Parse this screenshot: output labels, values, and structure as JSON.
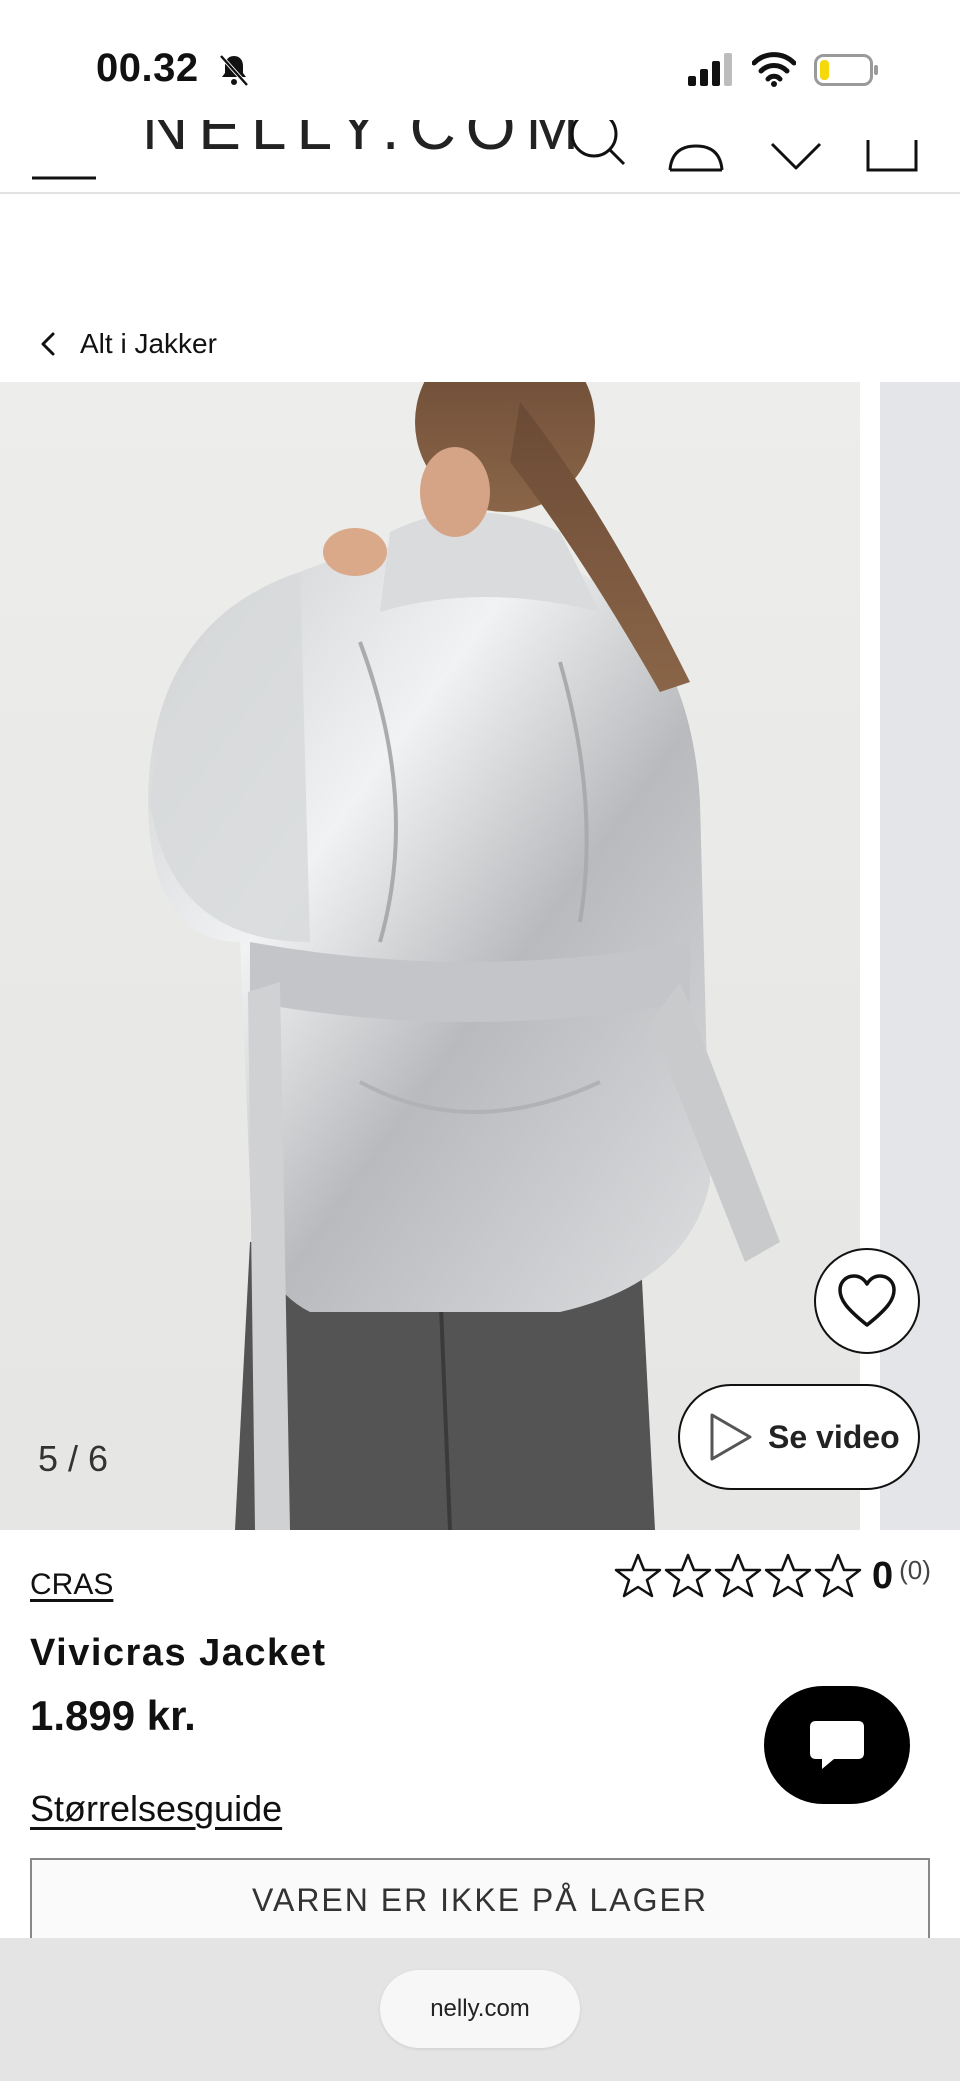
{
  "status_bar": {
    "time": "00.32"
  },
  "header": {
    "logo": "NELLY.COM"
  },
  "breadcrumb": {
    "label": "Alt i Jakker"
  },
  "gallery": {
    "counter": "5 / 6",
    "video_label": "Se video"
  },
  "product": {
    "brand": "CRAS",
    "rating_value": "0",
    "rating_count": "(0)",
    "name": "Vivicras Jacket",
    "price": "1.899 kr.",
    "size_guide": "Størrelsesguide",
    "stock_status": "VAREN ER IKKE PÅ LAGER"
  },
  "browser": {
    "url": "nelly.com"
  },
  "colors": {
    "accent": "#000000",
    "battery_level": "#f5d90a"
  },
  "battery_level": 0.2
}
